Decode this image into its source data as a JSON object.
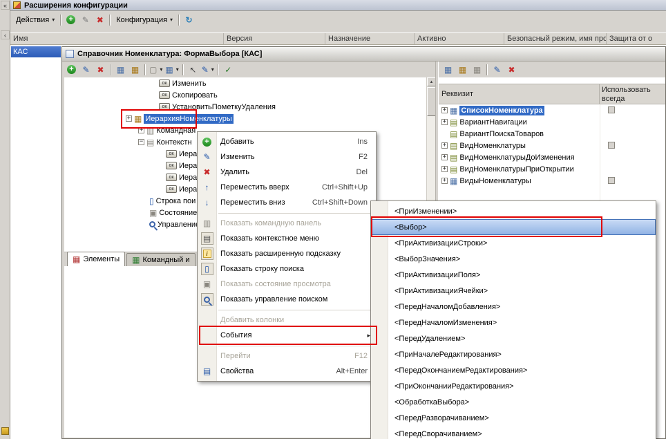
{
  "colors": {
    "selection": "#316ac5",
    "annotation": "#e00000"
  },
  "icons": {
    "dropdown": "▾",
    "plus": "+",
    "minus": "−",
    "edit": "✎",
    "del": "✖",
    "refresh": "↻",
    "up": "↑",
    "down": "↓",
    "check": "✓",
    "submenu": "▸",
    "ok": "ок",
    "table": "▦",
    "form": "▤",
    "panel": "▥",
    "state": "▣",
    "input": "▯",
    "square": "▢",
    "pointer": "↖",
    "scroll_up": "▲",
    "scroll_down": "▼",
    "chevrons": "«",
    "chevron": "‹",
    "info": "i"
  },
  "app": {
    "title": "Расширения конфигурации",
    "toolbar": {
      "actions_label": "Действия",
      "configuration_label": "Конфигурация"
    },
    "columns": [
      "Имя",
      "Версия",
      "Назначение",
      "Активно",
      "Безопасный режим, имя проф",
      "Защита от о"
    ],
    "selected_row": "КАС"
  },
  "designer": {
    "title": "Справочник Номенклатура: ФормаВыбора [КАС]",
    "tabs": [
      {
        "label": "Элементы"
      },
      {
        "label": "Командный и"
      }
    ],
    "tree": [
      {
        "label": "Изменить"
      },
      {
        "label": "Скопировать"
      },
      {
        "label": "УстановитьПометкуУдаления"
      },
      {
        "label": "ИерархияНоменклатуры"
      },
      {
        "label": "Командная"
      },
      {
        "label": "Контекстн"
      },
      {
        "label": "Иерар"
      },
      {
        "label": "Иерар"
      },
      {
        "label": "Иерар"
      },
      {
        "label": "Иерар"
      },
      {
        "label": "Строка пои"
      },
      {
        "label": "Состояние"
      },
      {
        "label": "Управление"
      }
    ],
    "attributes": {
      "col1": "Реквизит",
      "col2": "Использовать всегда",
      "items": [
        {
          "label": "СписокНоменклатура",
          "always_use": true
        },
        {
          "label": "ВариантНавигации",
          "always_use": false
        },
        {
          "label": "ВариантПоискаТоваров",
          "always_use": false
        },
        {
          "label": "ВидНоменклатуры",
          "always_use": true
        },
        {
          "label": "ВидНоменклатурыДоИзменения",
          "always_use": false
        },
        {
          "label": "ВидНоменклатурыПриОткрытии",
          "always_use": false
        },
        {
          "label": "ВидыНоменклатуры",
          "always_use": true
        }
      ]
    }
  },
  "context_menu": {
    "items": [
      {
        "label": "Добавить",
        "shortcut": "Ins"
      },
      {
        "label": "Изменить",
        "shortcut": "F2"
      },
      {
        "label": "Удалить",
        "shortcut": "Del"
      },
      {
        "label": "Переместить вверх",
        "shortcut": "Ctrl+Shift+Up"
      },
      {
        "label": "Переместить вниз",
        "shortcut": "Ctrl+Shift+Down"
      },
      {
        "label": "Показать командную панель",
        "disabled": true
      },
      {
        "label": "Показать контекстное меню"
      },
      {
        "label": "Показать расширенную подсказку"
      },
      {
        "label": "Показать строку поиска"
      },
      {
        "label": "Показать состояние просмотра",
        "disabled": true
      },
      {
        "label": "Показать управление поиском"
      },
      {
        "label": "Добавить колонки",
        "disabled": true
      },
      {
        "label": "События"
      },
      {
        "label": "Перейти",
        "shortcut": "F12",
        "disabled": true
      },
      {
        "label": "Свойства",
        "shortcut": "Alt+Enter"
      }
    ]
  },
  "events_submenu": {
    "items": [
      {
        "label": "<ПриИзменении>"
      },
      {
        "label": "<Выбор>",
        "selected": true
      },
      {
        "label": "<ПриАктивизацииСтроки>"
      },
      {
        "label": "<ВыборЗначения>"
      },
      {
        "label": "<ПриАктивизацииПоля>"
      },
      {
        "label": "<ПриАктивизацииЯчейки>"
      },
      {
        "label": "<ПередНачаломДобавления>"
      },
      {
        "label": "<ПередНачаломИзменения>"
      },
      {
        "label": "<ПередУдалением>"
      },
      {
        "label": "<ПриНачалеРедактирования>"
      },
      {
        "label": "<ПередОкончаниемРедактирования>"
      },
      {
        "label": "<ПриОкончанииРедактирования>"
      },
      {
        "label": "<ОбработкаВыбора>"
      },
      {
        "label": "<ПередРазворачиванием>"
      },
      {
        "label": "<ПередСворачиванием>"
      }
    ]
  }
}
